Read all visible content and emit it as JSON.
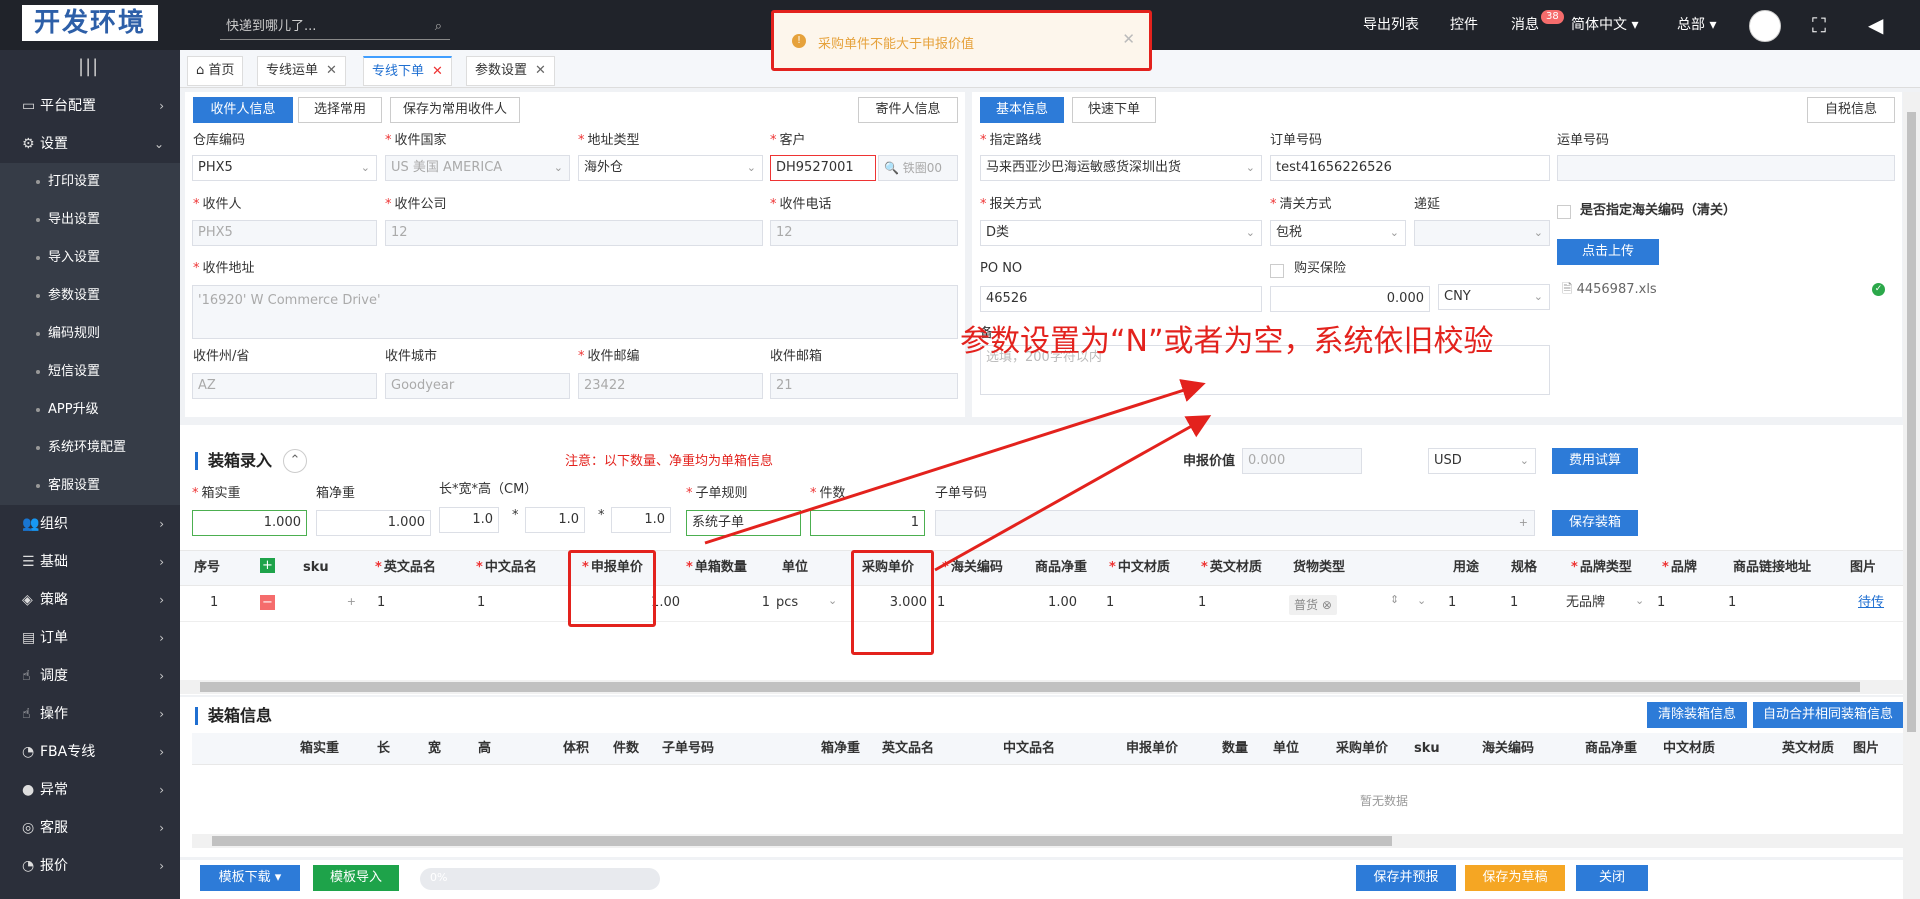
{
  "topbar": {
    "logo": "开发环境",
    "search_placeholder": "快递到哪儿了...",
    "nav": [
      "导出列表",
      "控件",
      "消息",
      "简体中文 ▾",
      "总部 ▾"
    ],
    "message_badge": "38"
  },
  "toast": {
    "text": "采购单件不能大于申报价值"
  },
  "sidebar": {
    "items": [
      {
        "label": "平台配置",
        "icon": "▭"
      },
      {
        "label": "设置",
        "icon": "⚙"
      },
      {
        "label": "组织",
        "icon": "👥"
      },
      {
        "label": "基础",
        "icon": "☰"
      },
      {
        "label": "策略",
        "icon": "◈"
      },
      {
        "label": "订单",
        "icon": "▤"
      },
      {
        "label": "调度",
        "icon": "☝"
      },
      {
        "label": "操作",
        "icon": "☝"
      },
      {
        "label": "FBA专线",
        "icon": "◔"
      },
      {
        "label": "异常",
        "icon": "●"
      },
      {
        "label": "客服",
        "icon": "◎"
      },
      {
        "label": "报价",
        "icon": "◔"
      }
    ],
    "subitems": [
      "打印设置",
      "导出设置",
      "导入设置",
      "参数设置",
      "编码规则",
      "短信设置",
      "APP升级",
      "系统环境配置",
      "客服设置"
    ]
  },
  "tabs": [
    {
      "label": "⌂ 首页"
    },
    {
      "label": "专线运单"
    },
    {
      "label": "专线下单"
    },
    {
      "label": "参数设置"
    }
  ],
  "receiver": {
    "btn_receiver_info": "收件人信息",
    "btn_select_common": "选择常用",
    "btn_save_common": "保存为常用收件人",
    "btn_sender_info": "寄件人信息",
    "warehouse_label": "仓库编码",
    "warehouse_value": "PHX5",
    "country_label": "收件国家",
    "country_value": "US 美国 AMERICA",
    "address_type_label": "地址类型",
    "address_type_value": "海外仓",
    "customer_label": "客户",
    "customer_value": "DH9527001",
    "customer_suffix": "🔍 铁圈00",
    "name_label": "收件人",
    "name_value": "PHX5",
    "company_label": "收件公司",
    "company_value": "12",
    "phone_label": "收件电话",
    "phone_value": "12",
    "address_label": "收件地址",
    "address_value": "'16920' W Commerce Drive'",
    "state_label": "收件州/省",
    "state_value": "AZ",
    "city_label": "收件城市",
    "city_value": "Goodyear",
    "zip_label": "收件邮编",
    "zip_value": "23422",
    "email_label": "收件邮箱",
    "email_value": "21"
  },
  "basic": {
    "btn_basic": "基本信息",
    "btn_quick": "快速下单",
    "btn_tax": "自税信息",
    "route_label": "指定路线",
    "route_value": "马来西亚沙巴海运敏感货深圳出货",
    "order_no_label": "订单号码",
    "order_no_value": "test41656226526",
    "waybill_label": "运单号码",
    "declare_label": "报关方式",
    "declare_value": "D类",
    "clearance_label": "清关方式",
    "clearance_value": "包税",
    "deferred_label": "递延",
    "hs_check_label": "是否指定海关编码（清关）",
    "upload_btn": "点击上传",
    "po_label": "PO NO",
    "po_value": "46526",
    "insurance_label": "购买保险",
    "insurance_value": "0.000",
    "currency_value": "CNY",
    "file_name": "4456987.xls",
    "remark_label": "备",
    "remark_placeholder": "选填，200字符以内"
  },
  "annotation": {
    "text": "参数设置为“N”或者为空，系统依旧校验"
  },
  "packing": {
    "title": "装箱录入",
    "notice": "注意：以下数量、净重均为单箱信息",
    "declared_label": "申报价值",
    "declared_value": "0.000",
    "currency": "USD",
    "fee_btn": "费用试算",
    "box_weight_label": "箱实重",
    "box_weight_value": "1.000",
    "box_net_label": "箱净重",
    "box_net_value": "1.000",
    "dims_label": "长*宽*高（CM）",
    "len": "1.0",
    "wid": "1.0",
    "hei": "1.0",
    "sub_rule_label": "子单规则",
    "sub_rule_value": "系统子单",
    "pieces_label": "件数",
    "pieces_value": "1",
    "sub_no_label": "子单号码",
    "save_btn": "保存装箱"
  },
  "items_table": {
    "headers": [
      "序号",
      "+",
      "sku",
      "英文品名",
      "中文品名",
      "申报单价",
      "单箱数量",
      "单位",
      "采购单价",
      "海关编码",
      "商品净重",
      "中文材质",
      "英文材质",
      "货物类型",
      "用途",
      "规格",
      "品牌类型",
      "品牌",
      "商品链接地址",
      "图片"
    ],
    "row": {
      "no": "1",
      "en_name": "1",
      "cn_name": "1",
      "declared_price": "1.00",
      "qty": "1",
      "unit": "pcs",
      "purchase_price": "3.000",
      "hs_code": "1",
      "net_weight": "1.00",
      "cn_material": "1",
      "en_material": "1",
      "cargo_type": "普货",
      "usage": "1",
      "spec": "1",
      "brand_type": "无品牌",
      "brand": "1",
      "link": "1",
      "image": "待传"
    }
  },
  "box_info": {
    "title": "装箱信息",
    "btn_clear": "清除装箱信息",
    "btn_merge": "自动合并相同装箱信息",
    "headers": [
      "箱实重",
      "长",
      "宽",
      "高",
      "体积",
      "件数",
      "子单号码",
      "箱净重",
      "英文品名",
      "中文品名",
      "申报单价",
      "数量",
      "单位",
      "采购单价",
      "sku",
      "海关编码",
      "商品净重",
      "中文材质",
      "英文材质",
      "图片"
    ],
    "empty": "暂无数据"
  },
  "footer": {
    "template_download": "模板下载 ▾",
    "template_import": "模板导入",
    "progress_text": "0%",
    "progress_value": 0,
    "save_report": "保存并预报",
    "save_draft": "保存为草稿",
    "close": "关闭"
  },
  "colors": {
    "accent": "#2d7bd8",
    "danger": "#e3221d",
    "sidebar": "#2b2f3a"
  }
}
